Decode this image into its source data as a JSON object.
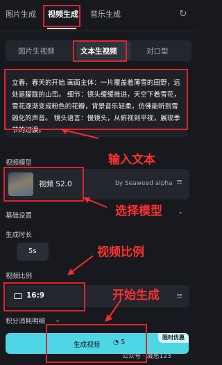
{
  "top_tabs": [
    {
      "label": "图片生成",
      "active": false
    },
    {
      "label": "视频生成",
      "active": true
    },
    {
      "label": "音乐生成",
      "active": false
    }
  ],
  "refresh_icon": "refresh-icon",
  "sub_tabs": [
    {
      "label": "图片生视频",
      "active": false
    },
    {
      "label": "文本生视频",
      "active": true
    },
    {
      "label": "对口型",
      "active": false
    }
  ],
  "prompt": {
    "text": "立春，春天的开始 画面主体：一片覆盖着薄雪的田野，远处是朦胧的山峦。 细节：镜头缓缓推进，天空下着雪花，雪花逐渐变成粉色的花瓣，背景音乐轻柔，仿佛能听到雪融化的声音。 镜头语言：慢镜头，从俯视到平视，展现季节的过渡。"
  },
  "model_section": {
    "title": "视频模型",
    "model_name": "视频 S2.0",
    "byline": "by Seaweed alpha",
    "settings_icon": "sliders-icon"
  },
  "basic": {
    "title": "基础设置",
    "duration_label": "生成时长",
    "duration_value": "5s",
    "ratio_label": "视频比例",
    "ratio_value": "16:9",
    "ratio_icon": "screen-icon",
    "credit_detail": "积分消耗明细"
  },
  "generate": {
    "label": "生成视频",
    "cost": "5",
    "cost_icon": "coin-icon",
    "badge": "限时优惠"
  },
  "annotations": {
    "input_text": "输入文本",
    "select_model": "选择模型",
    "video_ratio": "视频比例",
    "start_generate": "开始生成"
  },
  "watermark": "公众号 · 凝思123",
  "colors": {
    "accent": "#4ed6e6",
    "annotation_red": "#e0242b",
    "background": "#17191e"
  }
}
